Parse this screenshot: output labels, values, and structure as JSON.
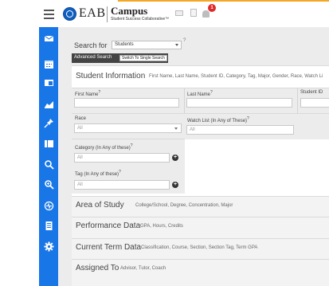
{
  "header": {
    "logo_eab": "EAB",
    "logo_campus": "Campus",
    "logo_tagline": "Student Success Collaborative™",
    "notification_count": "1"
  },
  "sidebar": {
    "icons": [
      "mail-icon",
      "calendar-icon",
      "folder-icon",
      "chart-icon",
      "pin-icon",
      "book-icon",
      "search-icon",
      "search-plus-icon",
      "activity-icon",
      "report-icon",
      "settings-icon"
    ]
  },
  "search": {
    "label": "Search for",
    "selected": "Students",
    "help": "?"
  },
  "advanced": {
    "label": "Advanced Search",
    "switch_label": "Switch To Single Search"
  },
  "student_info": {
    "title": "Student Information",
    "subtitle": "First Name, Last Name, Student ID, Category, Tag, Major, Gender, Race, Watch Li",
    "first_name_label": "First Name",
    "last_name_label": "Last Name",
    "student_id_label": "Student ID",
    "race_label": "Race",
    "race_value": "All",
    "watch_list_label": "Watch List (In Any of These)",
    "watch_list_placeholder": "All",
    "category_label": "Category (In Any of these)",
    "category_placeholder": "All",
    "tag_label": "Tag (In Any of these)",
    "tag_placeholder": "All",
    "help_mark": "?"
  },
  "sections": [
    {
      "title": "Area of Study",
      "subtitle": "College/School, Degree, Concentration, Major"
    },
    {
      "title": "Performance Data",
      "subtitle": "GPA, Hours, Credits"
    },
    {
      "title": "Current Term Data",
      "subtitle": "Classification, Course, Section, Section Tag, Term GPA"
    },
    {
      "title": "Assigned To",
      "subtitle": "Advisor, Tutor, Coach"
    }
  ],
  "colors": {
    "sidebar": "#1976e6",
    "accent": "#f5a623",
    "badge": "#e02a2a"
  }
}
